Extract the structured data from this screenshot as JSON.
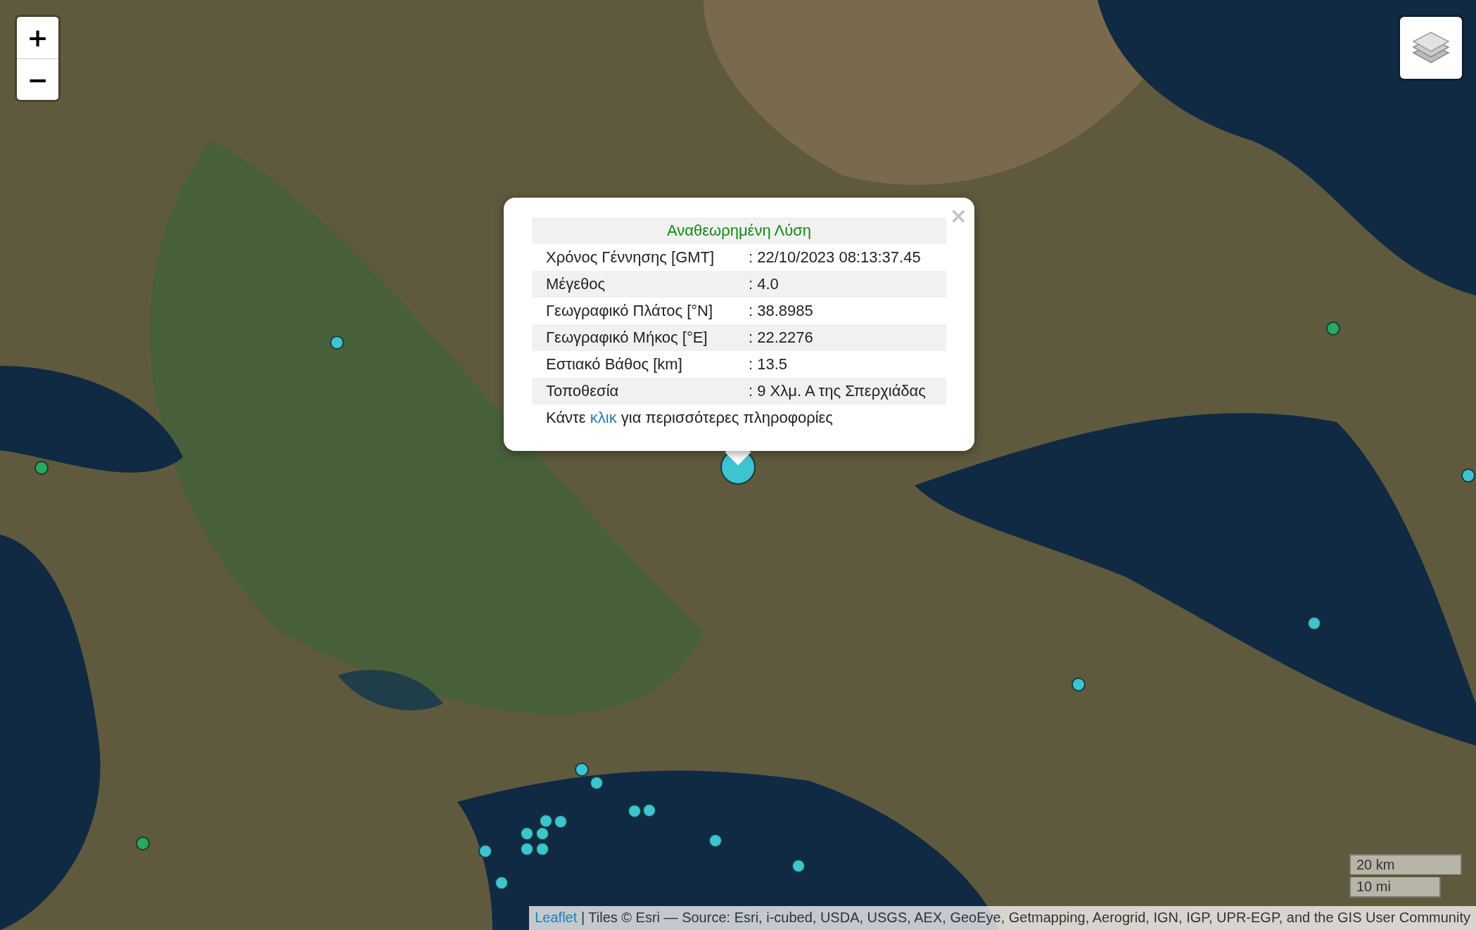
{
  "zoom_controls": [
    {
      "label": "+"
    },
    {
      "label": "−"
    }
  ],
  "popup": {
    "title": "Αναθεωρημένη Λύση",
    "close": "×",
    "rows": [
      {
        "label": "Χρόνος Γέννησης [GMT]",
        "value": ": 22/10/2023 08:13:37.45"
      },
      {
        "label": "Μέγεθος",
        "value": ": 4.0"
      },
      {
        "label": "Γεωγραφικό Πλάτος [°N]",
        "value": ": 38.8985"
      },
      {
        "label": "Γεωγραφικό Μήκος [°E]",
        "value": ": 22.2276"
      },
      {
        "label": "Εστιακό Βάθος [km]",
        "value": ": 13.5"
      },
      {
        "label": "Τοποθεσία",
        "value": ": 9 Χλμ. Α της Σπερχιάδας"
      }
    ],
    "footer": {
      "before": "Κάντε",
      "link": "κλικ",
      "after": "για περισσότερες πληροφορίες"
    }
  },
  "markers": [
    {
      "color": "#3cc4d0",
      "selected": false
    },
    {
      "color": "#2aa860",
      "selected": false
    },
    {
      "color": "#2aa860",
      "selected": false
    },
    {
      "color": "#3cc4d0",
      "selected": false
    },
    {
      "color": "#3cc4d0",
      "selected": false
    },
    {
      "color": "#3cc4d0",
      "selected": false
    },
    {
      "color": "#3cc4d0",
      "selected": false
    },
    {
      "color": "#3cc4d0",
      "selected": false
    },
    {
      "color": "#3cc4d0",
      "selected": false
    },
    {
      "color": "#3cc4d0",
      "selected": false
    },
    {
      "color": "#3cc4d0",
      "selected": false
    },
    {
      "color": "#3cc4d0",
      "selected": false
    },
    {
      "color": "#3cc4d0",
      "selected": false
    },
    {
      "color": "#3cc4d0",
      "selected": false
    },
    {
      "color": "#3cc4d0",
      "selected": false
    },
    {
      "color": "#3cc4d0",
      "selected": false
    },
    {
      "color": "#3cc4d0",
      "selected": false
    },
    {
      "color": "#3cc4d0",
      "selected": false
    },
    {
      "color": "#3cc4d0",
      "selected": false
    },
    {
      "color": "#3cc4d0",
      "selected": false
    },
    {
      "color": "#2aa860",
      "selected": false
    },
    {
      "color": "#3cc4d0",
      "selected": true
    }
  ],
  "scale": [
    "20 km",
    "10 mi"
  ],
  "attribution": {
    "link": "Leaflet",
    "text": "| Tiles © Esri — Source: Esri, i-cubed, USDA, USGS, AEX, GeoEye, Getmapping, Aerogrid, IGN, IGP, UPR-EGP, and the GIS User Community"
  }
}
